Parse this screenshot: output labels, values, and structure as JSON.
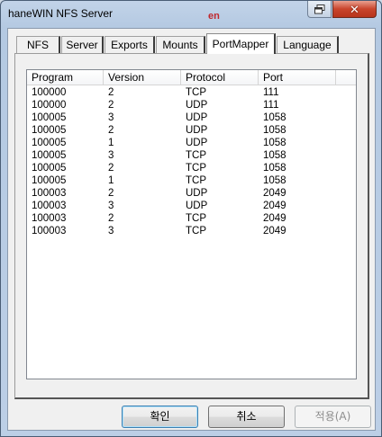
{
  "window": {
    "title": "haneWIN NFS Server",
    "lang_badge": "en"
  },
  "tabs": [
    {
      "label": "NFS",
      "active": false
    },
    {
      "label": "Server",
      "active": false
    },
    {
      "label": "Exports",
      "active": false
    },
    {
      "label": "Mounts",
      "active": false
    },
    {
      "label": "PortMapper",
      "active": true
    },
    {
      "label": "Language",
      "active": false
    }
  ],
  "table": {
    "columns": [
      "Program",
      "Version",
      "Protocol",
      "Port"
    ],
    "rows": [
      [
        "100000",
        "2",
        "TCP",
        "111"
      ],
      [
        "100000",
        "2",
        "UDP",
        "111"
      ],
      [
        "100005",
        "3",
        "UDP",
        "1058"
      ],
      [
        "100005",
        "2",
        "UDP",
        "1058"
      ],
      [
        "100005",
        "1",
        "UDP",
        "1058"
      ],
      [
        "100005",
        "3",
        "TCP",
        "1058"
      ],
      [
        "100005",
        "2",
        "TCP",
        "1058"
      ],
      [
        "100005",
        "1",
        "TCP",
        "1058"
      ],
      [
        "100003",
        "2",
        "UDP",
        "2049"
      ],
      [
        "100003",
        "3",
        "UDP",
        "2049"
      ],
      [
        "100003",
        "2",
        "TCP",
        "2049"
      ],
      [
        "100003",
        "3",
        "TCP",
        "2049"
      ]
    ]
  },
  "buttons": {
    "ok": "확인",
    "cancel": "취소",
    "apply": "적용(A)"
  },
  "icons": {
    "restore": "restore-icon",
    "close": "close-icon"
  }
}
